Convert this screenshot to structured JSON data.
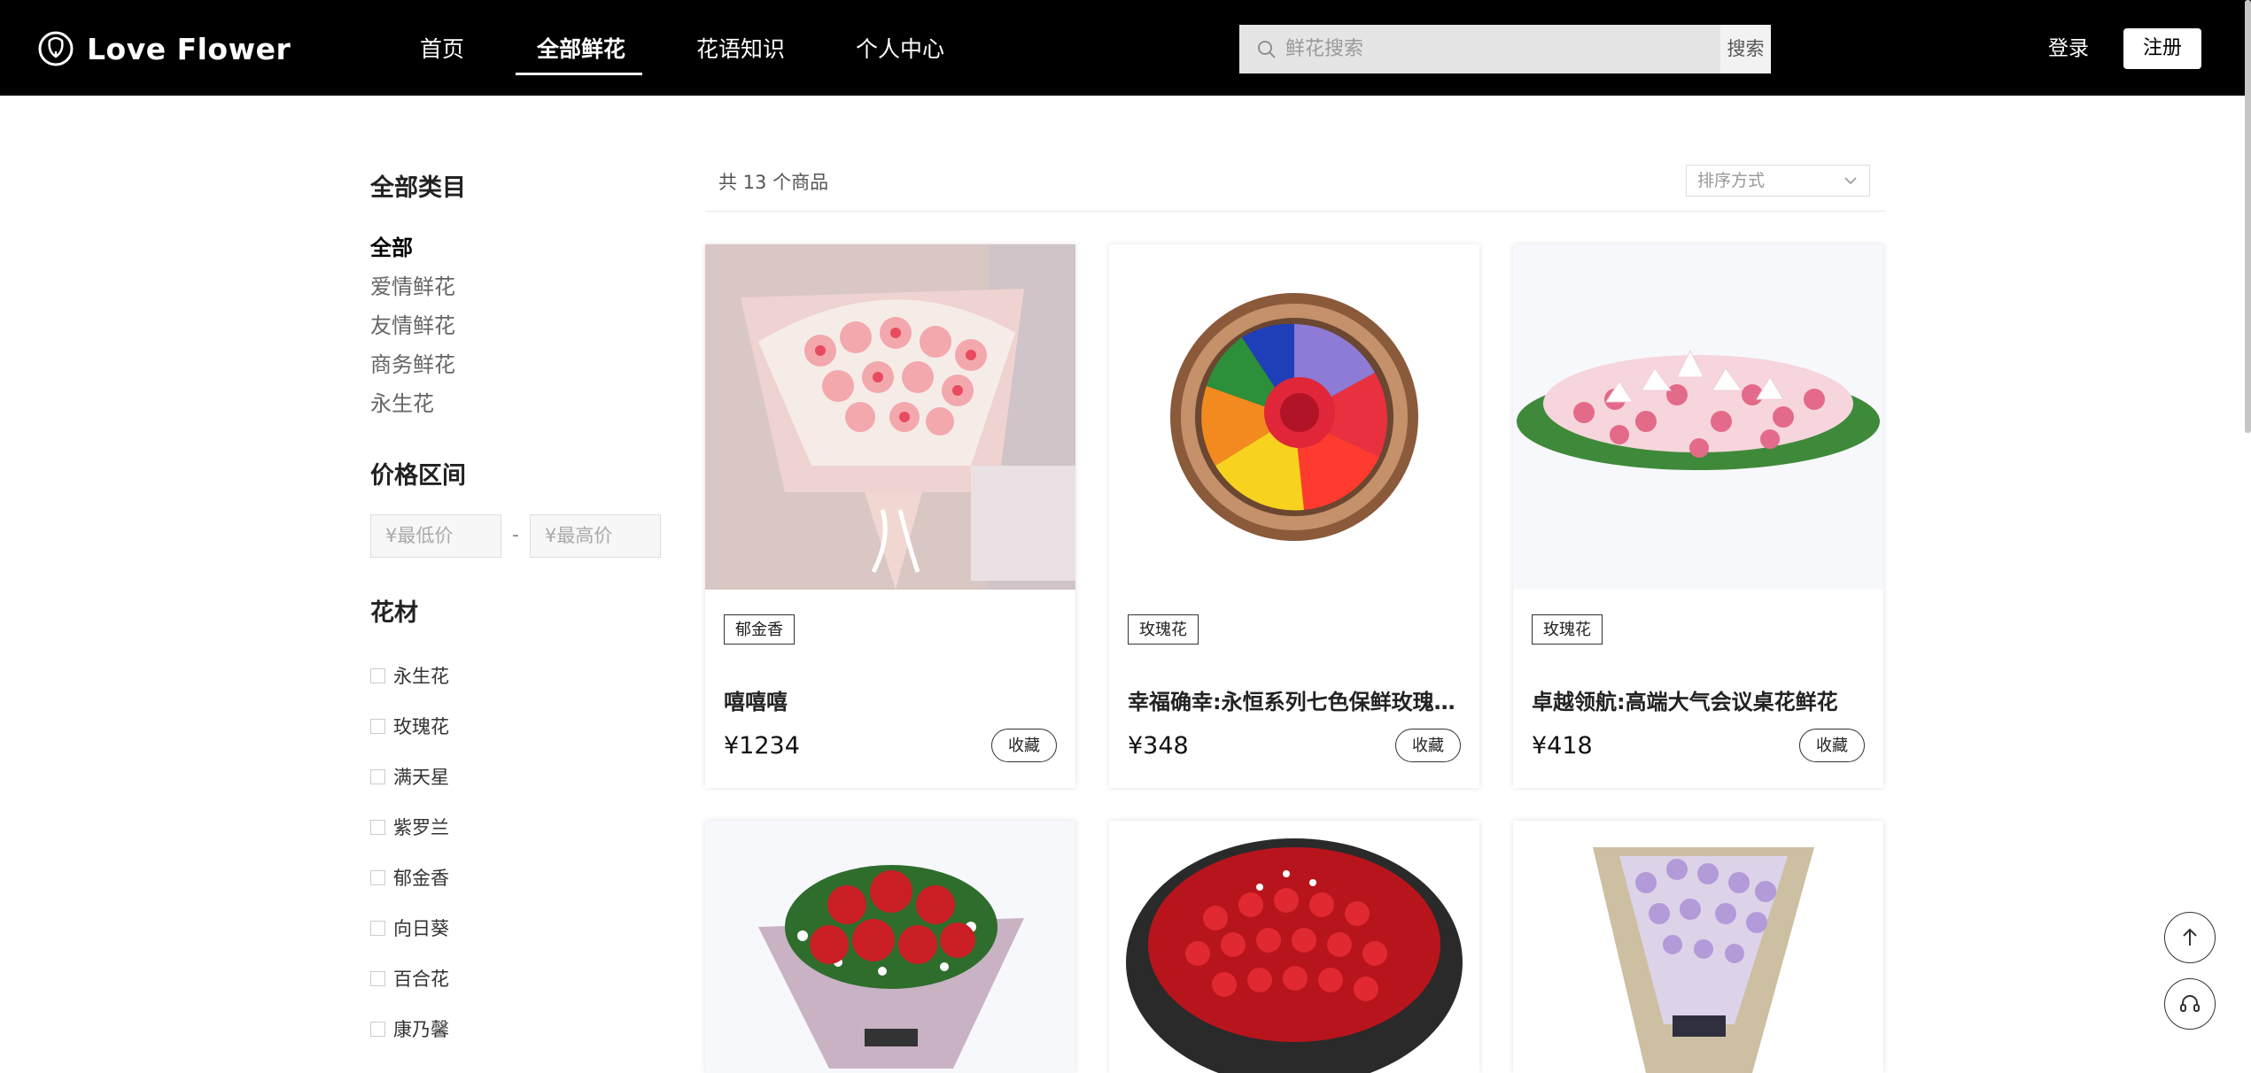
{
  "header": {
    "brand": "Love Flower",
    "nav": [
      "首页",
      "全部鲜花",
      "花语知识",
      "个人中心"
    ],
    "active_nav": "全部鲜花",
    "search_placeholder": "鲜花搜索",
    "search_button": "搜索",
    "login": "登录",
    "register": "注册"
  },
  "sidebar": {
    "category_title": "全部类目",
    "categories": [
      "全部",
      "爱情鲜花",
      "友情鲜花",
      "商务鲜花",
      "永生花"
    ],
    "active_category": "全部",
    "price_title": "价格区间",
    "min_price_placeholder": "¥最低价",
    "max_price_placeholder": "¥最高价",
    "price_separator": "-",
    "material_title": "花材",
    "materials": [
      "永生花",
      "玫瑰花",
      "满天星",
      "紫罗兰",
      "郁金香",
      "向日葵",
      "百合花",
      "康乃馨"
    ]
  },
  "main": {
    "count_text": "共 13 个商品",
    "sort_placeholder": "排序方式",
    "products": [
      {
        "tag": "郁金香",
        "name": "嘻嘻嘻",
        "price": "¥1234",
        "fav": "收藏",
        "image": "pink-rose-bouquet"
      },
      {
        "tag": "玫瑰花",
        "name": "幸福确幸:永恒系列七色保鲜玫瑰…",
        "price": "¥348",
        "fav": "收藏",
        "image": "rainbow-rose-box"
      },
      {
        "tag": "玫瑰花",
        "name": "卓越领航:高端大气会议桌花鲜花",
        "price": "¥418",
        "fav": "收藏",
        "image": "table-flower-arrangement"
      },
      {
        "image": "red-rose-bouquet"
      },
      {
        "image": "red-rose-large-bouquet"
      },
      {
        "image": "purple-stock-bouquet"
      }
    ]
  },
  "icons": {
    "logo": "flower-logo-icon",
    "search": "search-icon",
    "sort": "chevron-down-icon",
    "back_to_top": "arrow-up-icon",
    "support": "headset-icon"
  }
}
